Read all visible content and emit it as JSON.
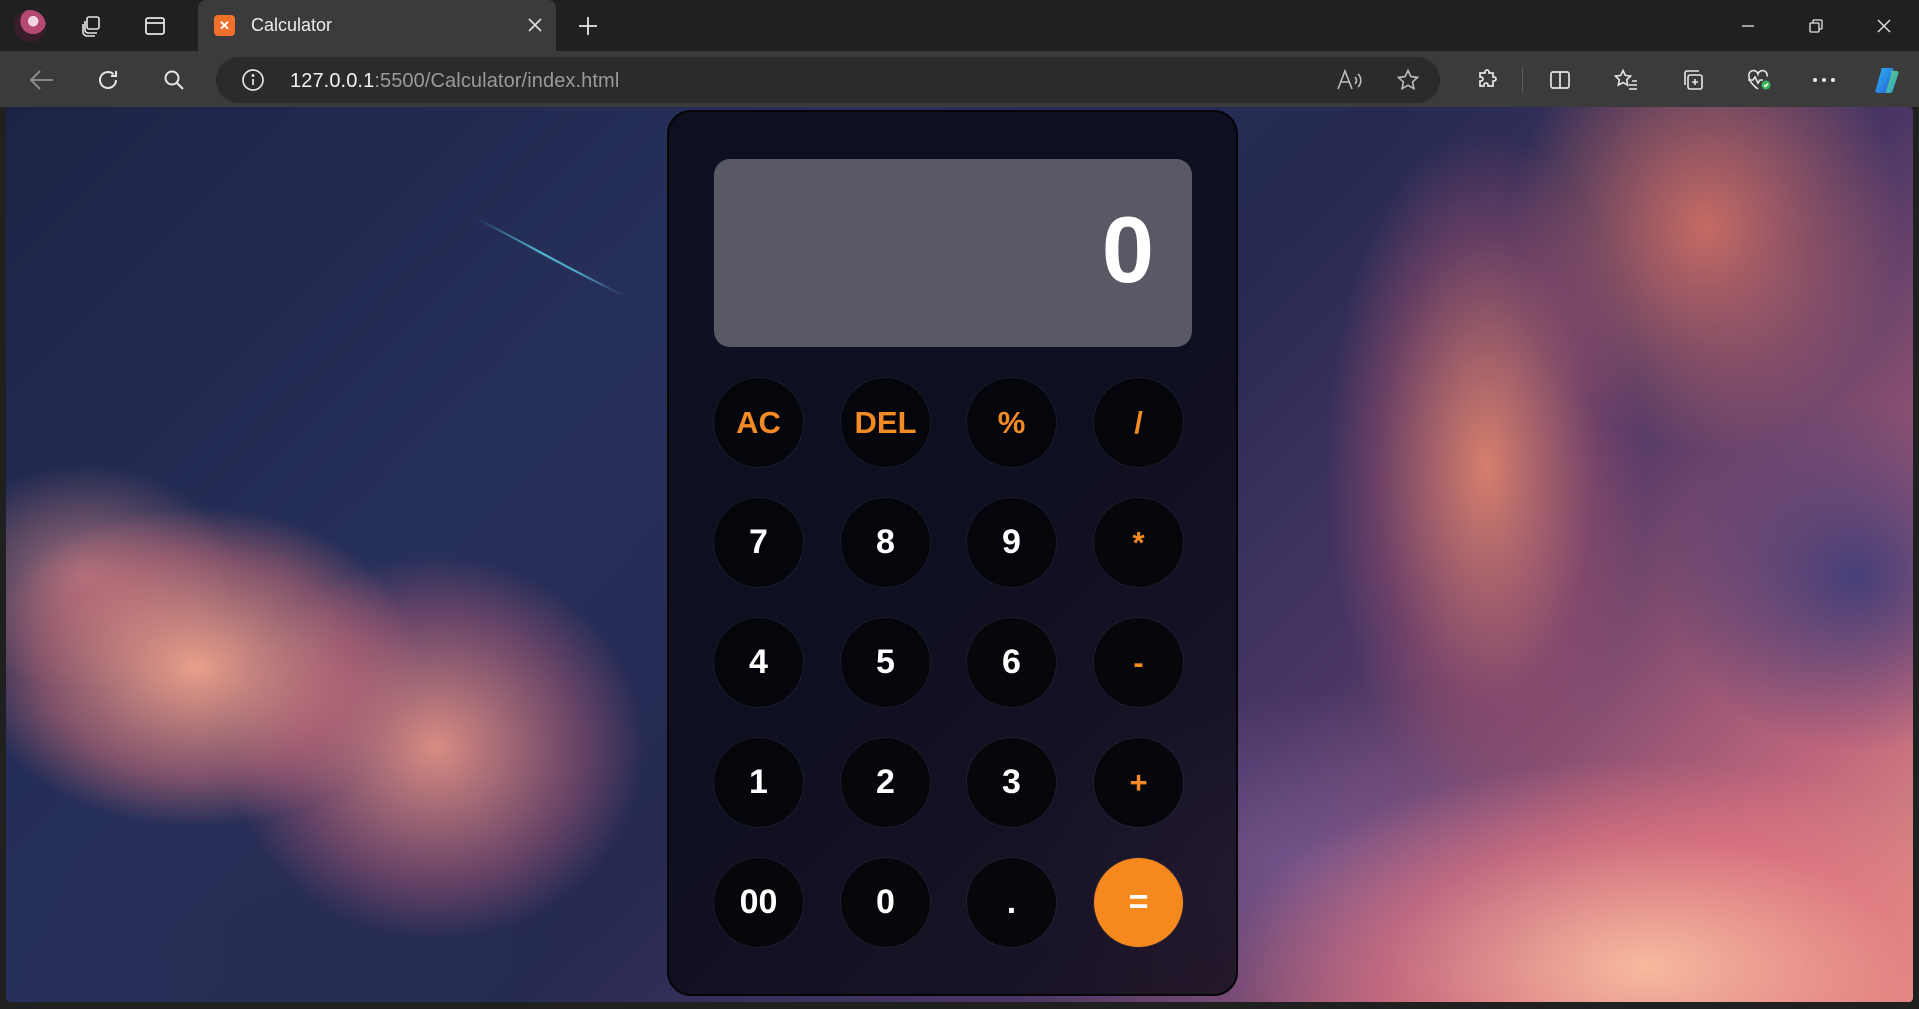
{
  "browser": {
    "tab": {
      "title": "Calculator",
      "favicon": "xampp-icon"
    },
    "address": {
      "host": "127.0.0.1",
      "rest": ":5500/Calculator/index.html"
    },
    "icons": {
      "profile": "profile-avatar",
      "workspaces": "workspaces-icon",
      "tab_actions": "tab-actions-icon",
      "new_tab": "plus-icon",
      "back": "back-arrow-icon",
      "refresh": "refresh-icon",
      "search": "search-icon",
      "site_info": "info-icon",
      "read_aloud": "read-aloud-icon",
      "favorite": "star-icon",
      "extensions": "puzzle-icon",
      "split_screen": "split-screen-icon",
      "favorites": "favorites-icon",
      "collections": "collections-icon",
      "browser_essentials": "heart-pulse-icon",
      "more": "more-icon",
      "copilot": "copilot-icon"
    }
  },
  "calculator": {
    "display": "0",
    "rows": [
      [
        {
          "label": "AC",
          "type": "op"
        },
        {
          "label": "DEL",
          "type": "op"
        },
        {
          "label": "%",
          "type": "op"
        },
        {
          "label": "/",
          "type": "op"
        }
      ],
      [
        {
          "label": "7",
          "type": "num"
        },
        {
          "label": "8",
          "type": "num"
        },
        {
          "label": "9",
          "type": "num"
        },
        {
          "label": "*",
          "type": "op"
        }
      ],
      [
        {
          "label": "4",
          "type": "num"
        },
        {
          "label": "5",
          "type": "num"
        },
        {
          "label": "6",
          "type": "num"
        },
        {
          "label": "-",
          "type": "op"
        }
      ],
      [
        {
          "label": "1",
          "type": "num"
        },
        {
          "label": "2",
          "type": "num"
        },
        {
          "label": "3",
          "type": "num"
        },
        {
          "label": "+",
          "type": "op"
        }
      ],
      [
        {
          "label": "00",
          "type": "num"
        },
        {
          "label": "0",
          "type": "num"
        },
        {
          "label": ".",
          "type": "num"
        },
        {
          "label": "=",
          "type": "eq"
        }
      ]
    ],
    "colors": {
      "accent": "#f5891e",
      "operator_text": "#f38a24"
    }
  }
}
